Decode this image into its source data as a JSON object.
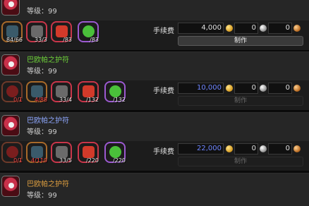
{
  "recipes": [
    {
      "name": "",
      "name_color": "#e0a040",
      "level": "等级：99",
      "fee_label": "手续费",
      "fee": "4,000",
      "silver": "0",
      "copper": "0",
      "make_label": "制作",
      "make_enabled": true,
      "materials": [
        {
          "icon": "pouch-icon",
          "count": "84/66",
          "bad": false
        },
        {
          "icon": "whirlwind-icon",
          "count": "33/3",
          "bad": false
        },
        {
          "icon": "red-gem-icon",
          "count": "/83",
          "bad": false
        },
        {
          "icon": "green-orb-icon",
          "count": "/83",
          "bad": false
        }
      ]
    },
    {
      "name": "巴欧帕之护符",
      "name_color": "#6fd43a",
      "level": "等级：99",
      "fee_label": "手续费",
      "fee": "10,000",
      "silver": "0",
      "copper": "0",
      "make_label": "制作",
      "make_enabled": false,
      "materials": [
        {
          "icon": "red-amulet-icon",
          "count": "0/1",
          "bad": true
        },
        {
          "icon": "pouch-icon",
          "count": "4/88",
          "bad": true
        },
        {
          "icon": "whirlwind-icon",
          "count": "33/4",
          "bad": false
        },
        {
          "icon": "red-gem-icon",
          "count": "/132",
          "bad": false
        },
        {
          "icon": "green-orb-icon",
          "count": "/132",
          "bad": false
        }
      ]
    },
    {
      "name": "巴欧帕之护符",
      "name_color": "#8fa8ff",
      "level": "等级：99",
      "fee_label": "手续费",
      "fee": "22,000",
      "silver": "0",
      "copper": "0",
      "make_label": "制作",
      "make_enabled": false,
      "materials": [
        {
          "icon": "red-amulet-icon",
          "count": "0/1",
          "bad": true
        },
        {
          "icon": "pouch-icon",
          "count": "4/110",
          "bad": true
        },
        {
          "icon": "whirlwind-icon",
          "count": "33/5",
          "bad": false
        },
        {
          "icon": "red-gem-icon",
          "count": "/220",
          "bad": false
        },
        {
          "icon": "green-orb-icon",
          "count": "/220",
          "bad": false
        }
      ]
    },
    {
      "name": "巴欧帕之护符",
      "name_color": "#e0a040",
      "level": "等级：99"
    }
  ]
}
